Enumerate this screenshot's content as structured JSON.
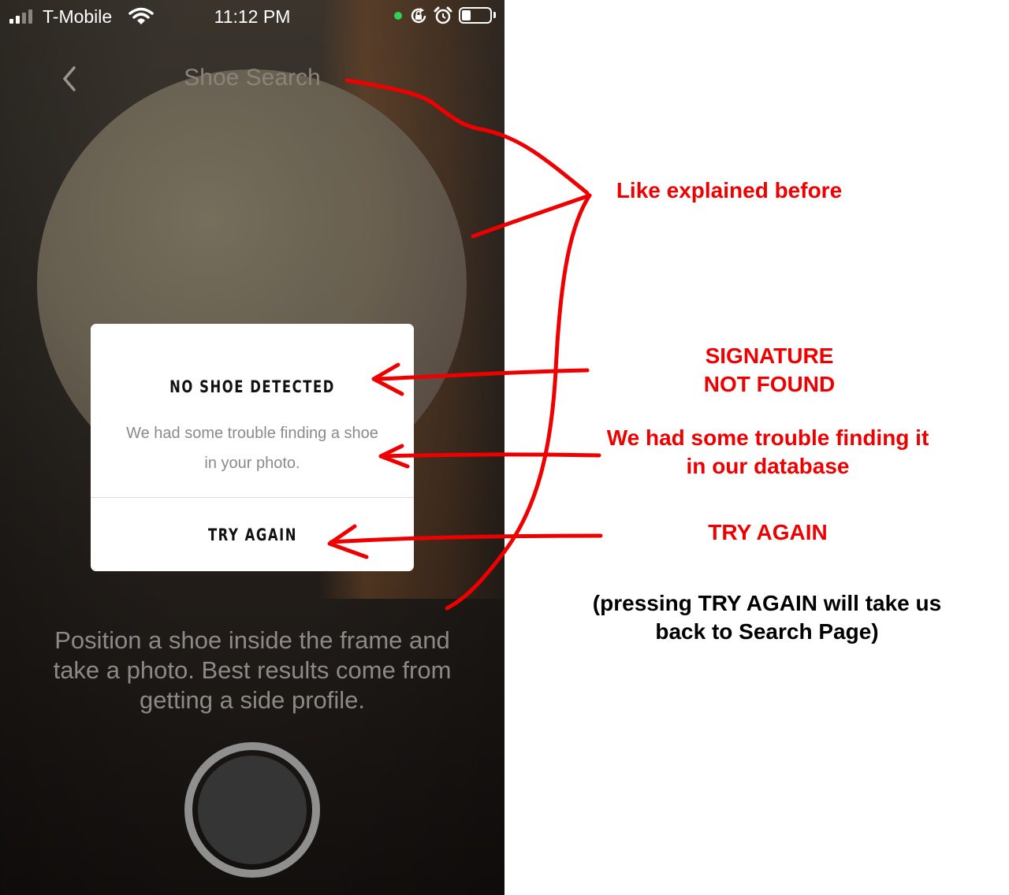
{
  "status_bar": {
    "carrier": "T-Mobile",
    "time": "11:12 PM",
    "icons": [
      "cellular-signal-icon",
      "wifi-icon",
      "camera-in-use-dot",
      "orientation-lock-icon",
      "alarm-icon",
      "battery-icon"
    ],
    "battery_level": 0.25
  },
  "nav": {
    "back_icon": "chevron-left-icon",
    "title": "Shoe Search"
  },
  "dialog": {
    "title": "NO SHOE DETECTED",
    "message": "We had some trouble finding a shoe in your photo.",
    "button_label": "TRY AGAIN"
  },
  "instructions": "Position a shoe inside the frame and take a photo. Best results come from getting a side profile.",
  "shutter_icon": "shutter-button",
  "annotations": {
    "like_explained": "Like explained before",
    "signature_line1": "SIGNATURE",
    "signature_line2": "NOT FOUND",
    "trouble_line1": "We had some trouble finding it",
    "trouble_line2": "in our database",
    "try_again": "TRY AGAIN",
    "note_line1": "(pressing TRY AGAIN will take us",
    "note_line2": "back to Search Page)"
  },
  "colors": {
    "annotation_red": "#ee0000",
    "camera_dot": "#31d158",
    "dialog_bg": "#ffffff"
  }
}
